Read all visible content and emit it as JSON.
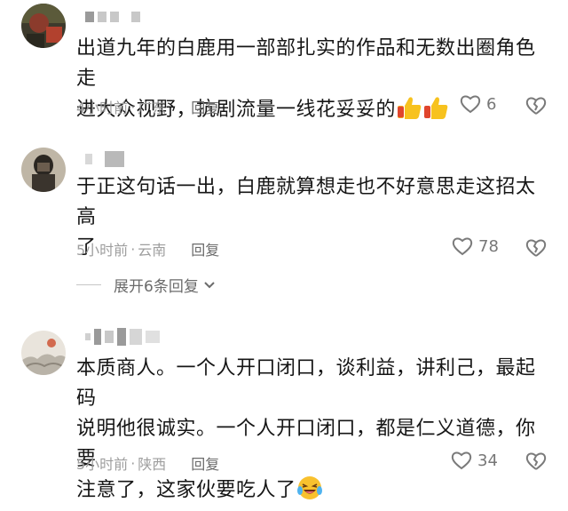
{
  "comments": [
    {
      "text_line1": "出道九年的白鹿用一部部扎实的作品和无数出圈角色走",
      "text_line2": "进大众视野，抗剧流量一线花妥妥的",
      "emoji": "thumbs-up-icon",
      "time": "4小时前",
      "location": "广东",
      "reply_label": "回复",
      "likes": "6"
    },
    {
      "text_line1": "于正这句话一出，白鹿就算想走也不好意思走这招太高",
      "text_line2": "了",
      "time": "5小时前",
      "location": "云南",
      "reply_label": "回复",
      "likes": "78",
      "expand_label": "展开6条回复"
    },
    {
      "text_line1": "本质商人。一个人开口闭口，谈利益，讲利己，最起码",
      "text_line2": "说明他很诚实。一个人开口闭口，都是仁义道德，你要",
      "text_line3": "注意了，这家伙要吃人了",
      "emoji": "laughing-tears-icon",
      "time": "5小时前",
      "location": "陕西",
      "reply_label": "回复",
      "likes": "34"
    }
  ],
  "colors": {
    "text": "#161616",
    "meta": "#9e9e9e",
    "reply": "#6b6b6b",
    "icon": "#7a7a7a"
  }
}
